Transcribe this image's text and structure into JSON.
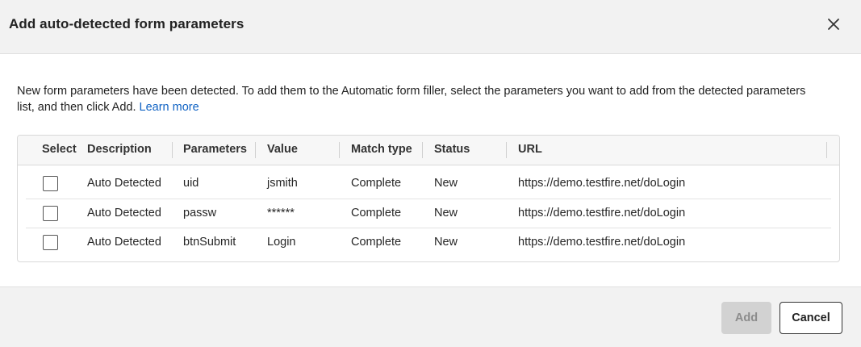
{
  "dialog": {
    "title": "Add auto-detected form parameters",
    "close_icon": "close-icon"
  },
  "intro": {
    "text": "New form parameters have been detected. To add them to the Automatic form filler, select the parameters you want to add from the detected parameters list, and then click Add. ",
    "link": "Learn more",
    "link_color": "#0f62c4"
  },
  "table": {
    "columns": [
      "Select",
      "Description",
      "Parameters",
      "Value",
      "Match type",
      "Status",
      "URL"
    ],
    "rows": [
      {
        "checked": false,
        "description": "Auto Detected",
        "parameter": "uid",
        "value": "jsmith",
        "match_type": "Complete",
        "status": "New",
        "url": "https://demo.testfire.net/doLogin"
      },
      {
        "checked": false,
        "description": "Auto Detected",
        "parameter": "passw",
        "value": "******",
        "match_type": "Complete",
        "status": "New",
        "url": "https://demo.testfire.net/doLogin"
      },
      {
        "checked": false,
        "description": "Auto Detected",
        "parameter": "btnSubmit",
        "value": "Login",
        "match_type": "Complete",
        "status": "New",
        "url": "https://demo.testfire.net/doLogin"
      }
    ]
  },
  "footer": {
    "add_label": "Add",
    "add_disabled": true,
    "cancel_label": "Cancel"
  }
}
